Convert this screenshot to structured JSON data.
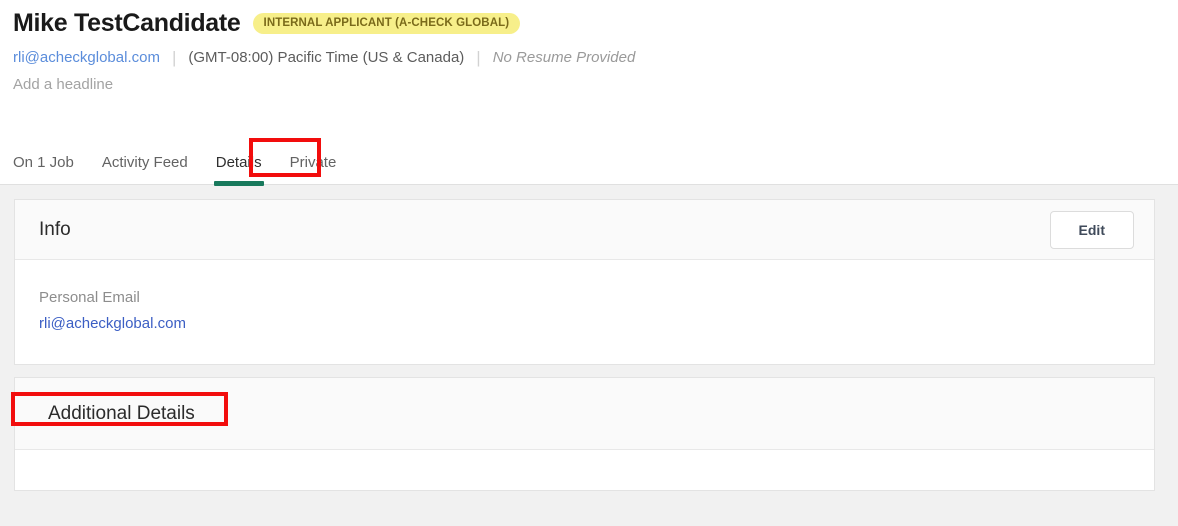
{
  "header": {
    "candidate_name": "Mike TestCandidate",
    "badge_label": "INTERNAL APPLICANT (A-CHECK GLOBAL)",
    "email": "rli@acheckglobal.com",
    "timezone": "(GMT-08:00) Pacific Time (US & Canada)",
    "resume_status": "No Resume Provided",
    "headline_placeholder": "Add a headline",
    "separator": "|"
  },
  "tabs": [
    {
      "label": "On 1 Job",
      "active": false
    },
    {
      "label": "Activity Feed",
      "active": false
    },
    {
      "label": "Details",
      "active": true
    },
    {
      "label": "Private",
      "active": false
    }
  ],
  "cards": [
    {
      "title": "Info",
      "action_label": "Edit",
      "fields": [
        {
          "label": "Personal Email",
          "value": "rli@acheckglobal.com",
          "type": "link"
        }
      ]
    },
    {
      "title": "Additional Details"
    }
  ],
  "colors": {
    "accent_green": "#18795c",
    "badge_bg": "#f7ef8a",
    "badge_text": "#7a6a1a",
    "link_blue": "#3b5ec4",
    "meta_link_blue": "#5b8ddb",
    "annotation_red": "#f20d0d",
    "page_bg": "#f1f1f1",
    "card_header_bg": "#fafafa"
  }
}
